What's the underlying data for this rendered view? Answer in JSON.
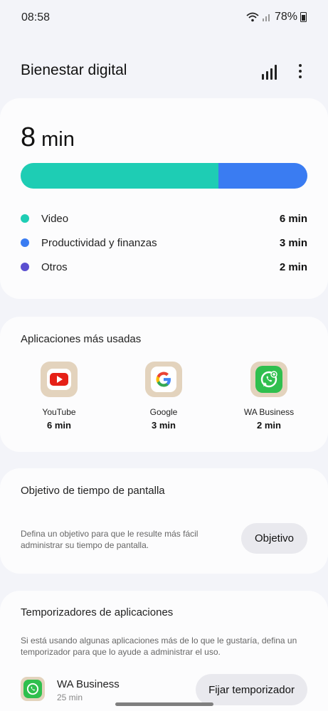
{
  "status_bar": {
    "time": "08:58",
    "battery": "78%"
  },
  "header": {
    "title": "Bienestar digital"
  },
  "usage": {
    "total_number": "8",
    "total_unit": "min",
    "categories": [
      {
        "label": "Video",
        "value": "6 min",
        "color": "#1ecdb4",
        "fraction": 0.69
      },
      {
        "label": "Productividad y finanzas",
        "value": "3 min",
        "color": "#3a7cf2",
        "fraction": 0.31
      },
      {
        "label": "Otros",
        "value": "2 min",
        "color": "#5b4fd0",
        "fraction": 0
      }
    ]
  },
  "most_used": {
    "title": "Aplicaciones más usadas",
    "apps": [
      {
        "name": "YouTube",
        "time": "6 min",
        "icon": "youtube-icon"
      },
      {
        "name": "Google",
        "time": "3 min",
        "icon": "google-icon"
      },
      {
        "name": "WA Business",
        "time": "2 min",
        "icon": "whatsapp-business-icon"
      }
    ]
  },
  "goal": {
    "title": "Objetivo de tiempo de pantalla",
    "description_line1": "Defina un objetivo para que le resulte más fácil",
    "description_line2": "administrar su tiempo de pantalla.",
    "button_label": "Objetivo"
  },
  "timers": {
    "title": "Temporizadores de aplicaciones",
    "description_line1": "Si está usando algunas aplicaciones más de lo que le gustaría, defina un",
    "description_line2": "temporizador para que lo ayude a administrar el uso.",
    "app_name": "WA Business",
    "app_time": "25 min",
    "button_label": "Fijar temporizador"
  }
}
